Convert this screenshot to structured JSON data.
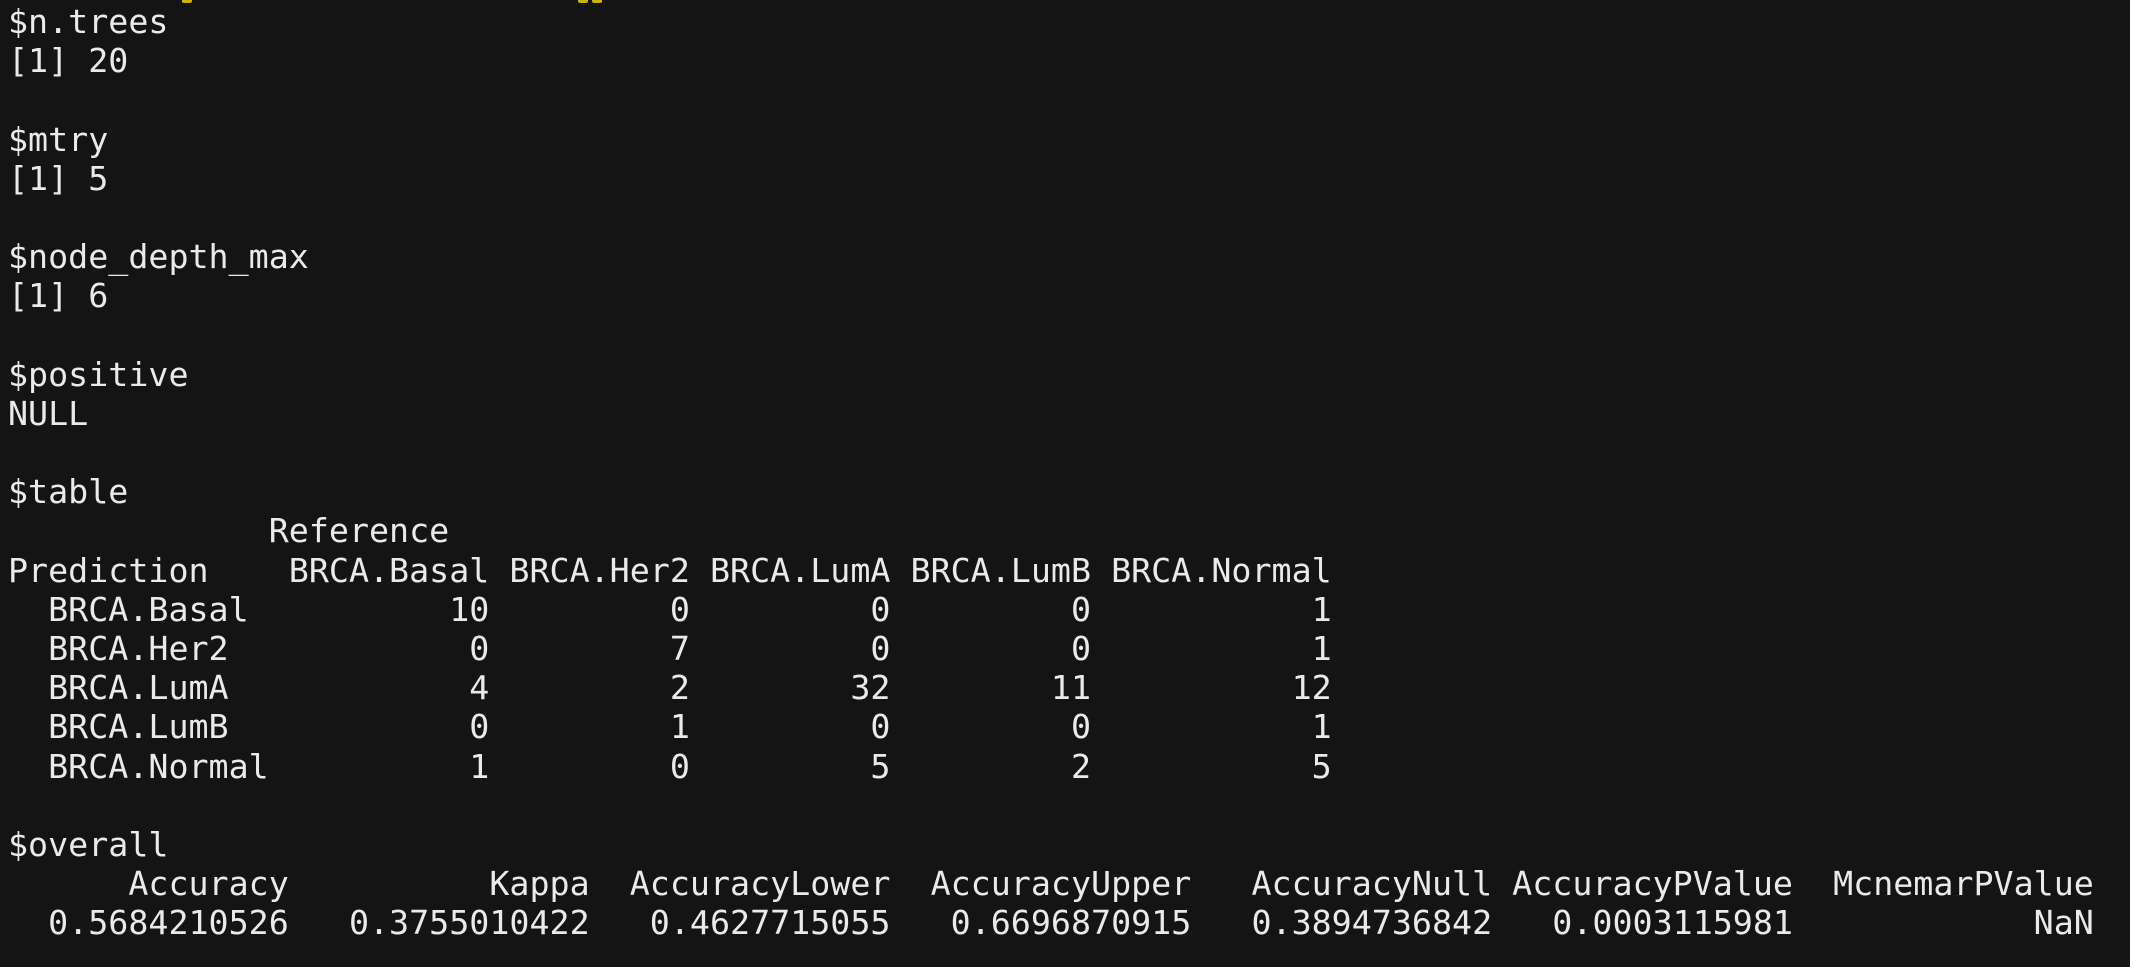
{
  "theme": {
    "background": "#141414",
    "foreground": "#eaeaea",
    "prompt_accent": "#c9b200"
  },
  "console": {
    "lines": [
      "$n.trees",
      "[1] 20",
      "",
      "$mtry",
      "[1] 5",
      "",
      "$node_depth_max",
      "[1] 6",
      "",
      "$positive",
      "NULL",
      "",
      "$table",
      "             Reference",
      "Prediction    BRCA.Basal BRCA.Her2 BRCA.LumA BRCA.LumB BRCA.Normal",
      "  BRCA.Basal          10         0         0         0           1",
      "  BRCA.Her2            0         7         0         0           1",
      "  BRCA.LumA            4         2        32        11          12",
      "  BRCA.LumB            0         1         0         0           1",
      "  BRCA.Normal          1         0         5         2           5",
      "",
      "$overall",
      "      Accuracy          Kappa  AccuracyLower  AccuracyUpper   AccuracyNull AccuracyPValue  McnemarPValue",
      "  0.5684210526   0.3755010422   0.4627715055   0.6696870915   0.3894736842   0.0003115981            NaN"
    ]
  }
}
